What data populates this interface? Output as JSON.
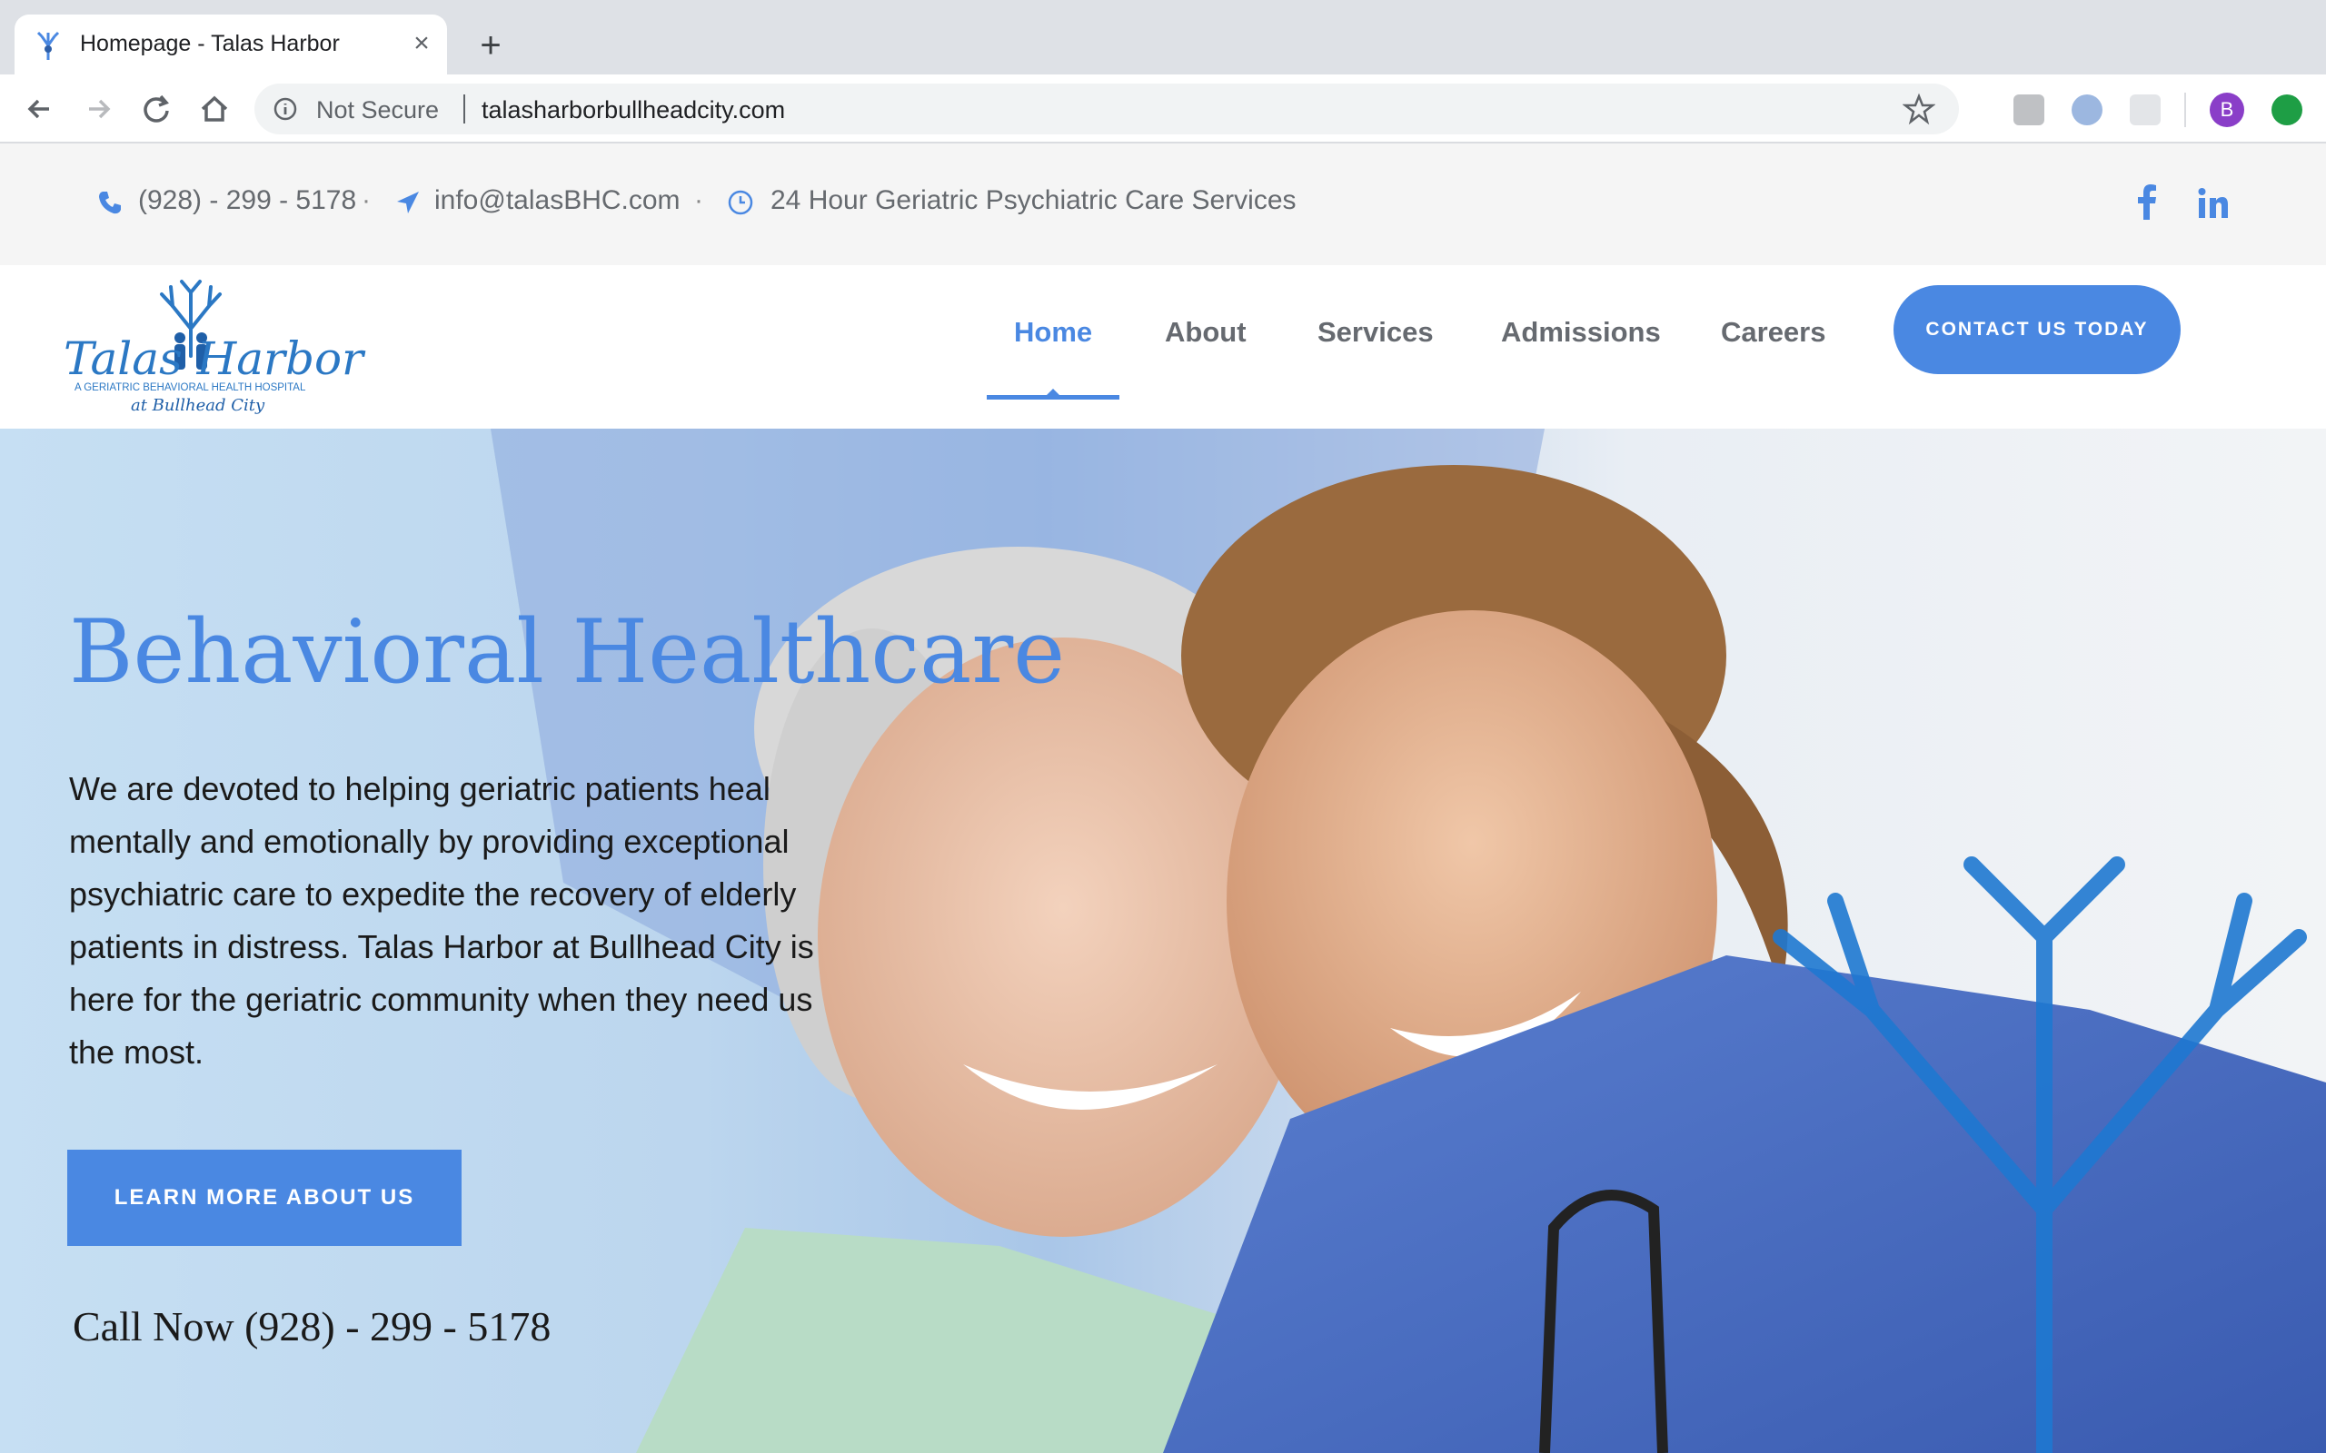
{
  "browser": {
    "tab_title": "Homepage - Talas Harbor",
    "new_tab_label": "+",
    "close_label": "×",
    "security_label": "Not Secure",
    "url": "talasharborbullheadcity.com",
    "profile_initial": "B"
  },
  "topbar": {
    "phone": "(928) - 299 - 5178",
    "email": "info@talasBHC.com",
    "hours": "24 Hour Geriatric Psychiatric Care Services",
    "separator": "·",
    "icons": [
      "phone-icon",
      "send-icon",
      "clock-icon",
      "facebook-icon",
      "linkedin-icon"
    ]
  },
  "logo": {
    "name": "Talas Harbor",
    "tagline": "A GERIATRIC BEHAVIORAL HEALTH HOSPITAL",
    "location": "at Bullhead City"
  },
  "nav": {
    "items": [
      {
        "label": "Home",
        "active": true
      },
      {
        "label": "About",
        "active": false
      },
      {
        "label": "Services",
        "active": false
      },
      {
        "label": "Admissions",
        "active": false
      },
      {
        "label": "Careers",
        "active": false
      }
    ],
    "cta": "CONTACT US TODAY"
  },
  "hero": {
    "title": "Behavioral Healthcare",
    "text": "We are devoted to helping geriatric patients heal mentally and emotionally by providing exceptional psychiatric care to expedite the recovery of elderly patients in distress. Talas Harbor at Bullhead City is here for the geriatric community when they need us the most.",
    "button": "LEARN MORE ABOUT US",
    "call_now": "Call Now (928) - 299 - 5178"
  },
  "colors": {
    "accent": "#4a88e2",
    "topbar_bg": "#f5f5f5",
    "text_dark": "#1a1a1a",
    "nav_text": "#666a70"
  }
}
